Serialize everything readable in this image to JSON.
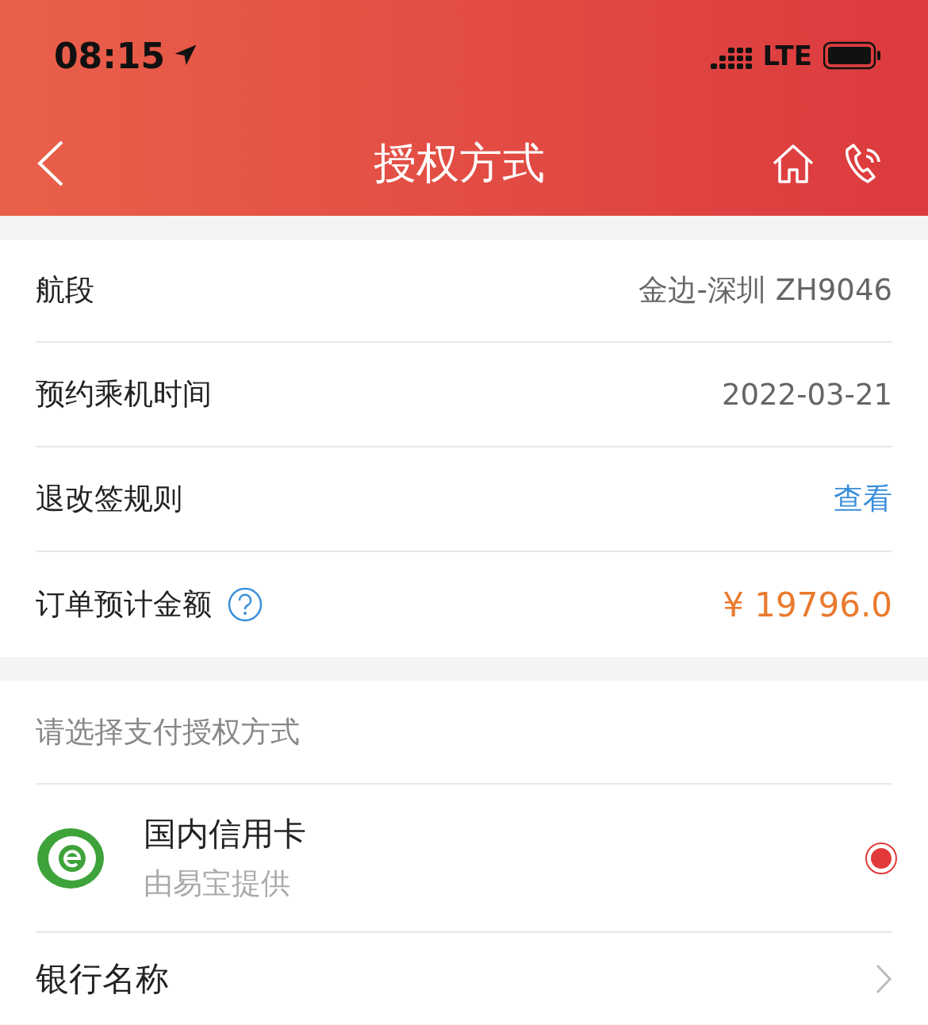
{
  "status_bar": {
    "time": "08:15",
    "network": "LTE"
  },
  "nav": {
    "title": "授权方式"
  },
  "info_rows": [
    {
      "label": "航段",
      "value": "金边-深圳 ZH9046",
      "kind": "text",
      "help": false
    },
    {
      "label": "预约乘机时间",
      "value": "2022-03-21",
      "kind": "text",
      "help": false
    },
    {
      "label": "退改签规则",
      "value": "查看",
      "kind": "link",
      "help": false
    },
    {
      "label": "订单预计金额",
      "value": "¥ 19796.0",
      "kind": "price",
      "help": true
    }
  ],
  "payment": {
    "heading": "请选择支付授权方式",
    "methods": [
      {
        "name": "国内信用卡",
        "provider": "由易宝提供",
        "selected": true
      }
    ],
    "bank": {
      "label": "银行名称"
    }
  }
}
